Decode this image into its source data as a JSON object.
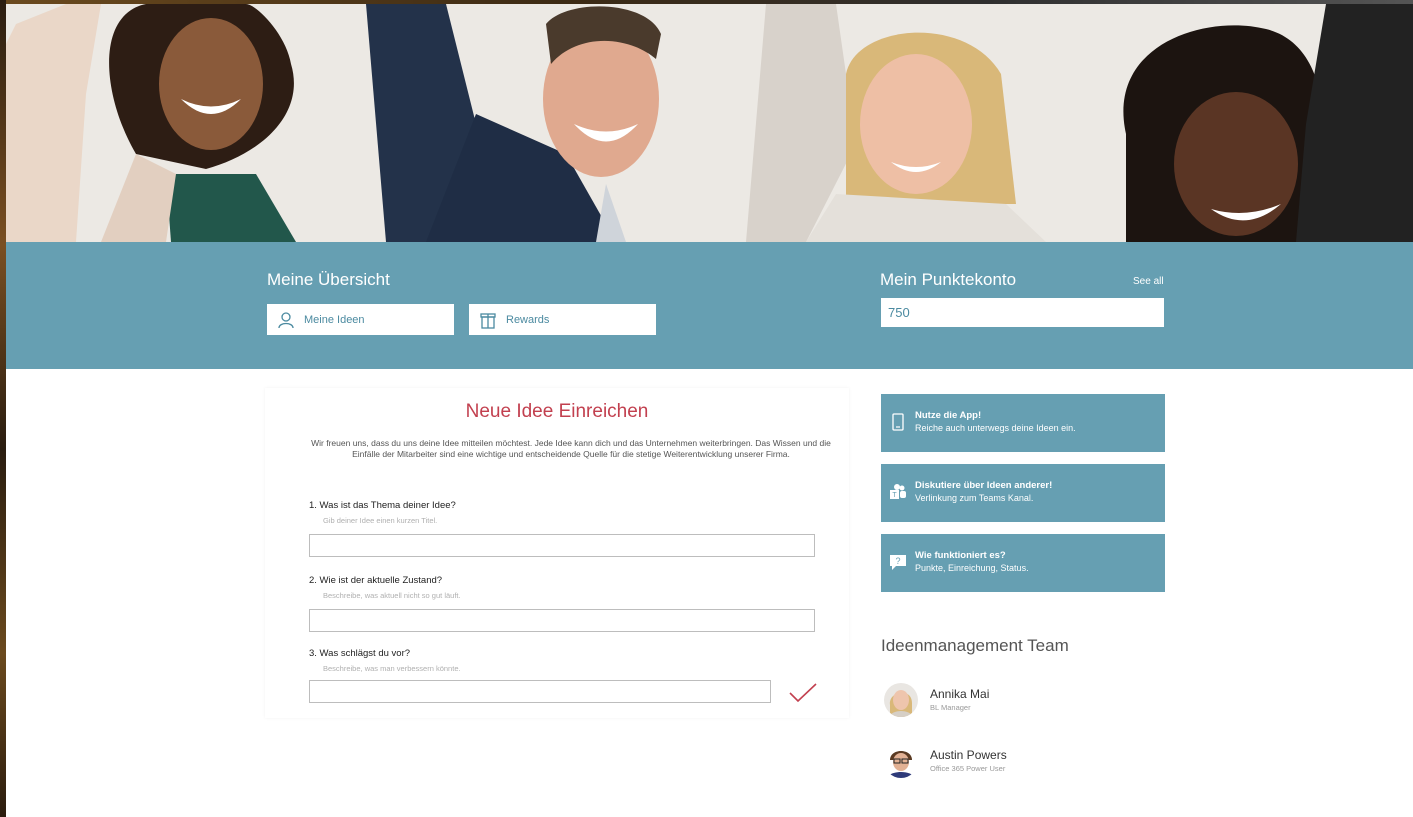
{
  "header": {
    "overview_title": "Meine Übersicht",
    "nav": [
      {
        "label": "Meine Ideen",
        "icon": "person-icon"
      },
      {
        "label": "Rewards",
        "icon": "gift-icon"
      }
    ],
    "points_title": "Mein Punktekonto",
    "see_all": "See all",
    "points_value": "750"
  },
  "form": {
    "title": "Neue Idee Einreichen",
    "intro": "Wir freuen uns, dass du uns deine Idee mitteilen möchtest. Jede Idee kann dich und das Unternehmen weiterbringen. Das Wissen und die Einfälle der Mitarbeiter sind eine wichtige und entscheidende Quelle für die stetige Weiterentwicklung unserer Firma.",
    "questions": [
      {
        "label": "1. Was ist das Thema deiner Idee?",
        "hint": "Gib deiner Idee einen kurzen Titel.",
        "value": ""
      },
      {
        "label": "2. Wie ist der aktuelle Zustand?",
        "hint": "Beschreibe, was aktuell nicht so gut läuft.",
        "value": ""
      },
      {
        "label": "3. Was schlägst du vor?",
        "hint": "Beschreibe, was man verbessern könnte.",
        "value": ""
      }
    ],
    "submit_icon": "checkmark-icon"
  },
  "sidebar": {
    "tiles": [
      {
        "title": "Nutze die App!",
        "subtitle": "Reiche auch unterwegs deine Ideen ein.",
        "icon": "phone-icon"
      },
      {
        "title": "Diskutiere über Ideen anderer!",
        "subtitle": "Verlinkung zum Teams Kanal.",
        "icon": "teams-icon"
      },
      {
        "title": "Wie funktioniert es?",
        "subtitle": "Punkte, Einreichung, Status.",
        "icon": "chat-question-icon"
      }
    ],
    "team_title": "Ideenmanagement Team",
    "team": [
      {
        "name": "Annika Mai",
        "role": "BL Manager"
      },
      {
        "name": "Austin Powers",
        "role": "Office 365 Power User"
      }
    ]
  },
  "colors": {
    "accent_blue": "#669fb2",
    "title_red": "#c2404f",
    "link_blue": "#4b8aa0"
  }
}
